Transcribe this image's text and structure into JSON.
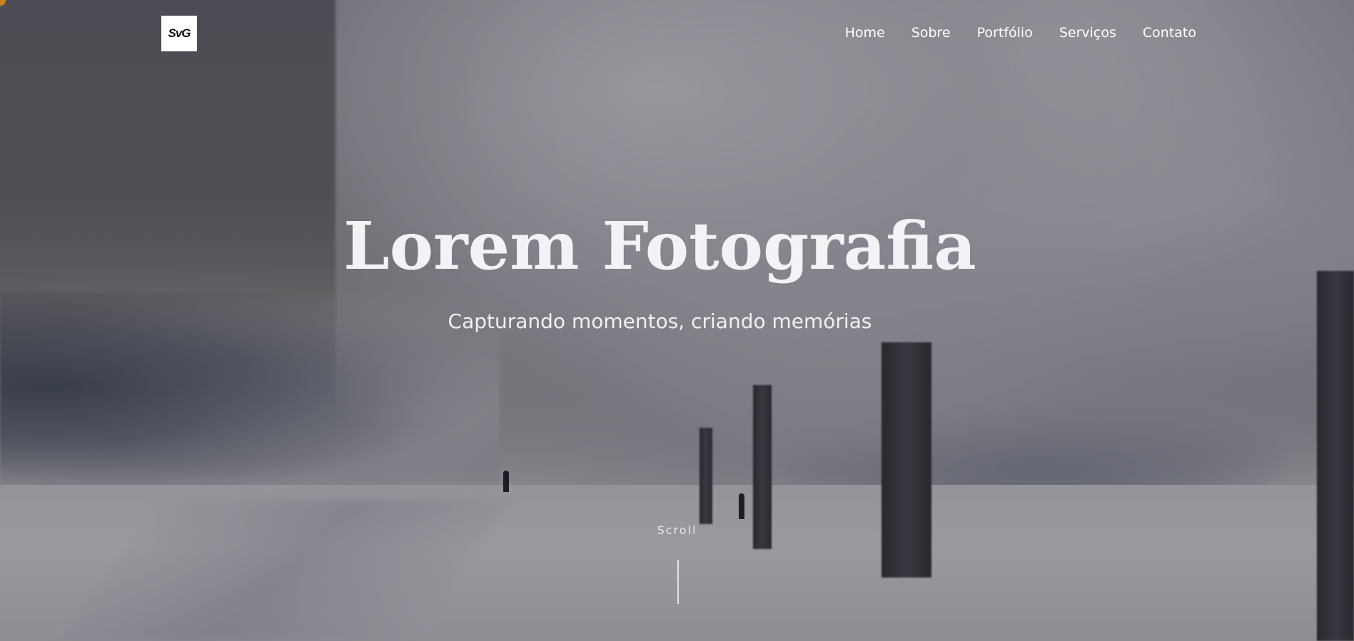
{
  "brand": {
    "logo_text": "SvG"
  },
  "nav": {
    "items": [
      {
        "label": "Home"
      },
      {
        "label": "Sobre"
      },
      {
        "label": "Portfólio"
      },
      {
        "label": "Serviços"
      },
      {
        "label": "Contato"
      }
    ]
  },
  "hero": {
    "title": "Lorem Fotografia",
    "subtitle": "Capturando momentos, criando memórias",
    "scroll_label": "Scroll",
    "background_description_colors": {
      "overlay": "#1e1e26",
      "snow": "#e6e6eb",
      "text": "#f3f3f5"
    }
  }
}
